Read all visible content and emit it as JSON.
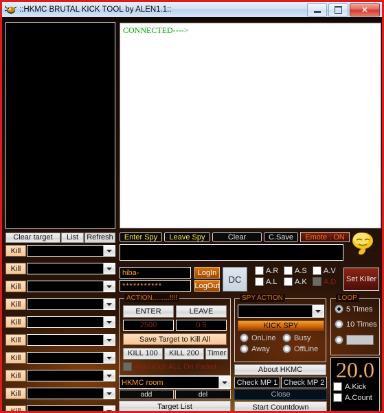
{
  "window": {
    "title": "::HKMC BRUTAL KICK TOOL by ALEN1.1::",
    "icon": "app-bug-icon",
    "minimize": "minimize",
    "maximize": "maximize",
    "close": "✕"
  },
  "left_panel": {
    "target_listbox_value": "",
    "toolbar": {
      "clear_target": "Clear target",
      "list": "List",
      "refresh": "Refresh"
    },
    "kill_label": "Kill",
    "kill_rows": [
      {
        "kill": "Kill",
        "value": ""
      },
      {
        "kill": "Kill",
        "value": ""
      },
      {
        "kill": "Kill",
        "value": ""
      },
      {
        "kill": "Kill",
        "value": ""
      },
      {
        "kill": "Kill",
        "value": ""
      },
      {
        "kill": "Kill",
        "value": ""
      },
      {
        "kill": "Kill",
        "value": ""
      },
      {
        "kill": "Kill",
        "value": ""
      },
      {
        "kill": "Kill",
        "value": ""
      },
      {
        "kill": "Kill",
        "value": ""
      }
    ]
  },
  "chat": {
    "log_text": "CONNECTED---->",
    "log_color": "#00a000",
    "input_value": ""
  },
  "spy_toolbar": {
    "enter_spy": "Enter Spy",
    "leave_spy": "Leave Spy",
    "clear": "Clear",
    "csave": "C.Save",
    "emote": "Emote : ON",
    "emoticon": "sleeping-face-icon"
  },
  "login": {
    "username": "hiba-",
    "password_mask": "***********",
    "login": "LogIn",
    "logout": "LogOut",
    "dc": "DC",
    "set_killer": "Set Killer",
    "flags": [
      {
        "label": "A.R",
        "checked": false,
        "disabled": false
      },
      {
        "label": "A.S",
        "checked": false,
        "disabled": false
      },
      {
        "label": "A.V",
        "checked": false,
        "disabled": false
      },
      {
        "label": "A.L",
        "checked": false,
        "disabled": false
      },
      {
        "label": "A.K",
        "checked": false,
        "disabled": false
      },
      {
        "label": "A.D",
        "checked": false,
        "disabled": true
      }
    ]
  },
  "action": {
    "legend": "ACTION.........!!!!",
    "enter": "ENTER",
    "leave": "LEAVE",
    "delay_1": "2500",
    "delay_2": "0.5",
    "save_target": "Save Target to Kill All",
    "kill_100": "KILL 100",
    "kill_200": "KILL 200",
    "timer": "Timer",
    "auto_kick": "Auto Kick ALL On Failed",
    "auto_kick_checked": false
  },
  "spy_action": {
    "legend": "SPY ACTION",
    "target_value": "",
    "kick_spy": "KICK SPY",
    "statuses": [
      {
        "label": "OnLine",
        "selected": false
      },
      {
        "label": "Busy",
        "selected": false
      },
      {
        "label": "Away",
        "selected": false
      },
      {
        "label": "OffLine",
        "selected": false
      }
    ],
    "about": "About HKMC",
    "check_mp1": "Check MP 1",
    "check_mp2": "Check MP 2",
    "close": "Close",
    "start_countdown": "Start Countdown"
  },
  "loop": {
    "legend": "LOOP",
    "options": [
      {
        "label": "5   Times",
        "selected": true
      },
      {
        "label": "10 Times",
        "selected": false
      },
      {
        "label": "",
        "selected": false
      }
    ],
    "custom_value": "",
    "counter": "20.0",
    "a_kick": "A.Kick",
    "a_kick_checked": false,
    "a_count": "A.Count",
    "a_count_checked": false
  },
  "room": {
    "room_value": "HKMC room",
    "add": "add",
    "del": "del",
    "target_list": "Target List"
  },
  "colors": {
    "frame": "#e01b1b",
    "orange_text": "#ff9b32",
    "legend": "#d9770a",
    "connected_green": "#00a000",
    "disabled_red": "#8a1f18"
  }
}
